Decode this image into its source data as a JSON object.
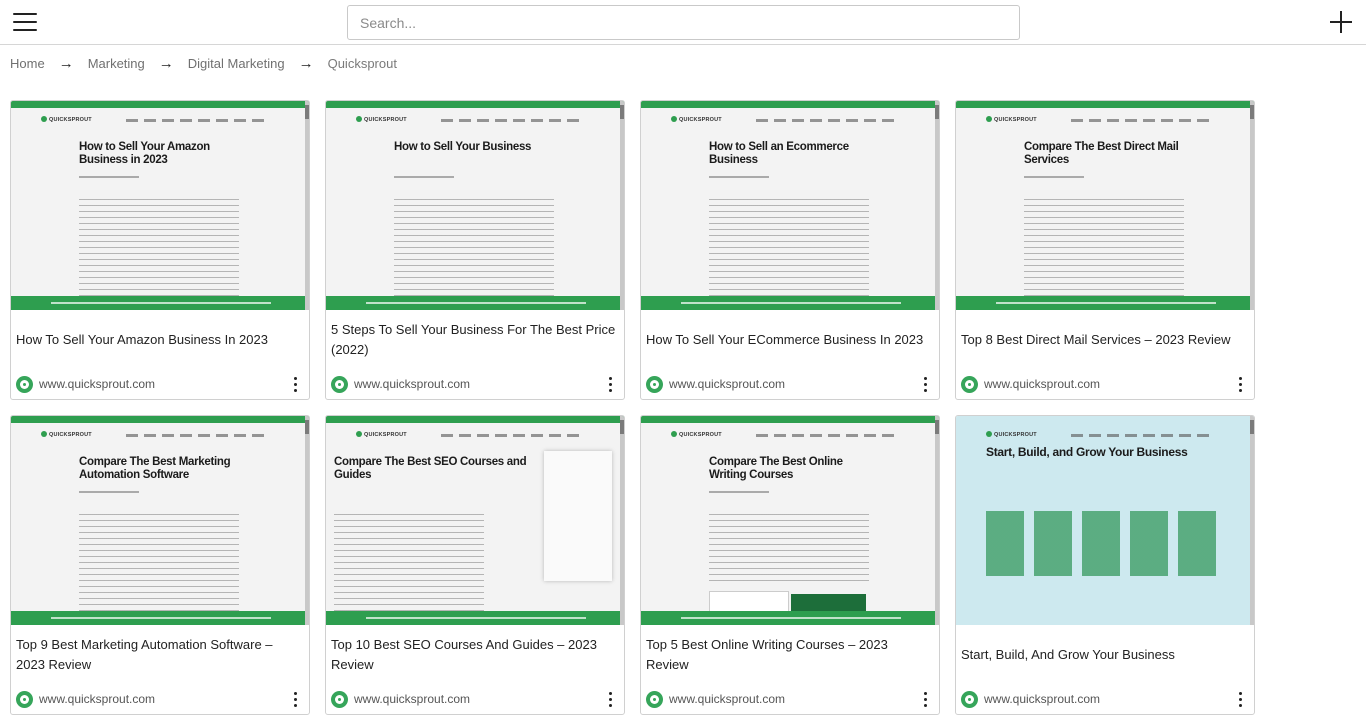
{
  "header": {
    "search_placeholder": "Search...",
    "menu_icon": "hamburger-menu-icon",
    "add_icon": "plus-icon"
  },
  "breadcrumb": {
    "items": [
      "Home",
      "Marketing",
      "Digital Marketing",
      "Quicksprout"
    ],
    "separator": "→"
  },
  "colors": {
    "brand_green": "#2e9e4f",
    "border": "#d0d0d0"
  },
  "cards": [
    {
      "title": "How To Sell Your Amazon Business In 2023",
      "domain": "www.quicksprout.com",
      "thumb_heading": "How to Sell Your Amazon Business in 2023"
    },
    {
      "title": "5 Steps To Sell Your Business For The Best Price (2022)",
      "domain": "www.quicksprout.com",
      "thumb_heading": "How to Sell Your Business"
    },
    {
      "title": "How To Sell Your ECommerce Business In 2023",
      "domain": "www.quicksprout.com",
      "thumb_heading": "How to Sell an Ecommerce Business"
    },
    {
      "title": "Top 8 Best Direct Mail Services – 2023 Review",
      "domain": "www.quicksprout.com",
      "thumb_heading": "Compare The Best Direct Mail Services"
    },
    {
      "title": "Top 9 Best Marketing Automation Software – 2023 Review",
      "domain": "www.quicksprout.com",
      "thumb_heading": "Compare The Best Marketing Automation Software"
    },
    {
      "title": "Top 10 Best SEO Courses And Guides – 2023 Review",
      "domain": "www.quicksprout.com",
      "thumb_heading": "Compare The Best SEO Courses and Guides"
    },
    {
      "title": "Top 5 Best Online Writing Courses – 2023 Review",
      "domain": "www.quicksprout.com",
      "thumb_heading": "Compare The Best Online Writing Courses"
    },
    {
      "title": "Start, Build, And Grow Your Business",
      "domain": "www.quicksprout.com",
      "thumb_heading": "Start, Build, and Grow Your Business"
    }
  ]
}
